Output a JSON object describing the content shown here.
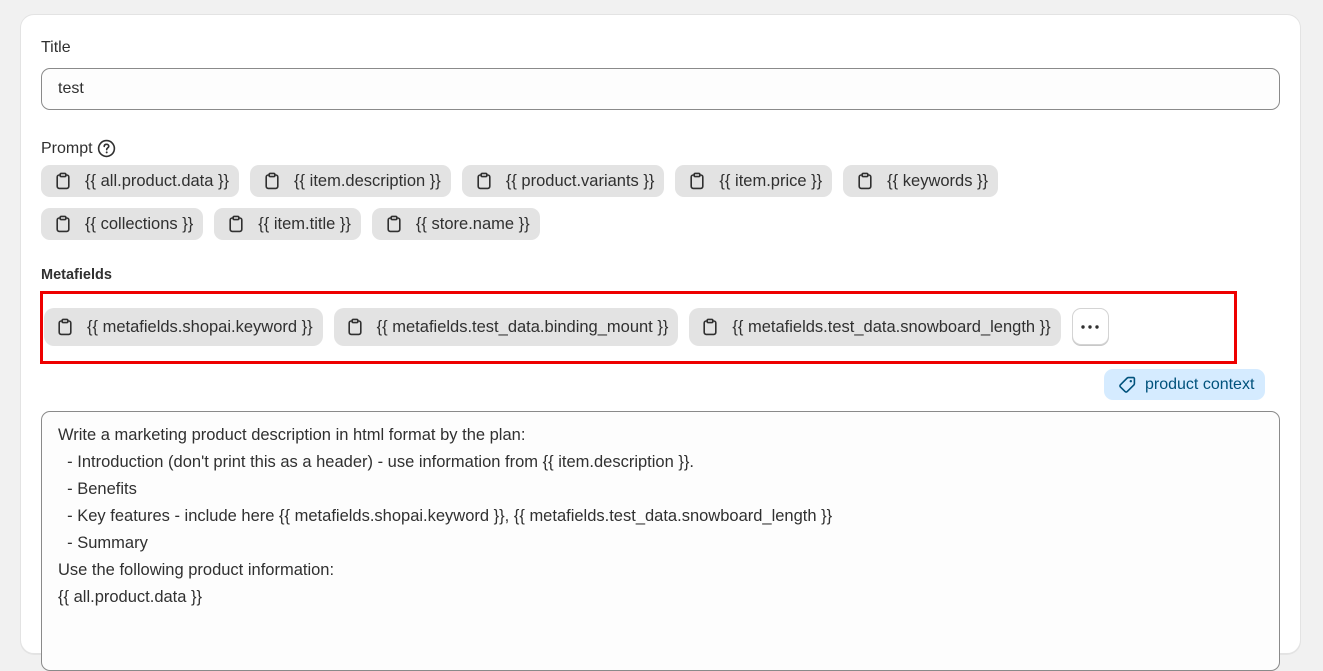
{
  "title_field": {
    "label": "Title",
    "value": "test"
  },
  "prompt": {
    "label": "Prompt",
    "help_icon": "question-circle-icon",
    "chips_row1": [
      "{{ all.product.data }}",
      "{{ item.description }}",
      "{{ product.variants }}",
      "{{ item.price }}",
      "{{ keywords }}"
    ],
    "chips_row2": [
      "{{ collections }}",
      "{{ item.title }}",
      "{{ store.name }}"
    ],
    "chip_icon": "clipboard-icon"
  },
  "metafields": {
    "label": "Metafields",
    "chips": [
      "{{ metafields.shopai.keyword }}",
      "{{ metafields.test_data.binding_mount }}",
      "{{ metafields.test_data.snowboard_length }}"
    ],
    "more_icon": "ellipsis-horizontal-icon",
    "highlight_color": "#ee0000"
  },
  "context_badge": {
    "label": "product context",
    "icon": "tag-icon",
    "background": "#d5ebff",
    "color": "#00527c"
  },
  "prompt_text": "Write a marketing product description in html format by the plan:\n  - Introduction (don't print this as a header) - use information from {{ item.description }}.\n  - Benefits\n  - Key features - include here {{ metafields.shopai.keyword }}, {{ metafields.test_data.snowboard_length }}\n  - Summary\nUse the following product information:\n{{ all.product.data }}"
}
